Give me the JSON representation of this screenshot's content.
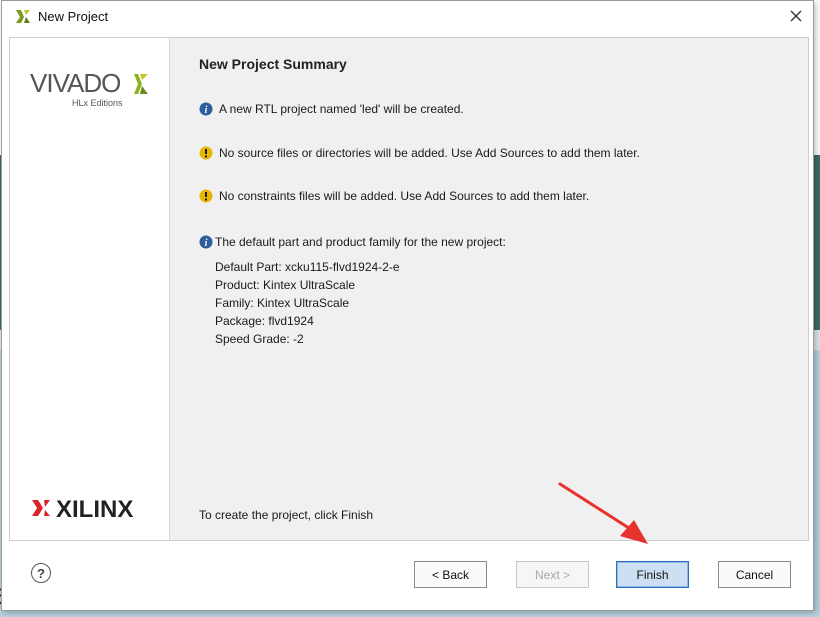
{
  "window": {
    "title": "New Project"
  },
  "brand": {
    "vivado_text": "VIVADO",
    "vivado_sub": "HLx Editions",
    "xilinx_text": "XILINX"
  },
  "summary": {
    "title": "New Project Summary",
    "messages": [
      {
        "type": "info",
        "text": "A new RTL project named 'led' will be created."
      },
      {
        "type": "warning",
        "text": "No source files or directories will be added. Use Add Sources to add them later."
      },
      {
        "type": "warning",
        "text": "No constraints files will be added. Use Add Sources to add them later."
      },
      {
        "type": "info",
        "text": "The default part and product family for the new project:"
      }
    ],
    "details": [
      "Default Part: xcku115-flvd1924-2-e",
      "Product: Kintex UltraScale",
      "Family: Kintex UltraScale",
      "Package: flvd1924",
      "Speed Grade: -2"
    ],
    "footer": "To create the project, click Finish"
  },
  "buttons": {
    "help": "?",
    "back": "< Back",
    "next": "Next >",
    "finish": "Finish",
    "cancel": "Cancel"
  },
  "background_text": "e",
  "colors": {
    "info": "#2d5d9a",
    "warning": "#e8b600",
    "arrow": "#e8322e",
    "finish_bg": "#cde0f3"
  }
}
